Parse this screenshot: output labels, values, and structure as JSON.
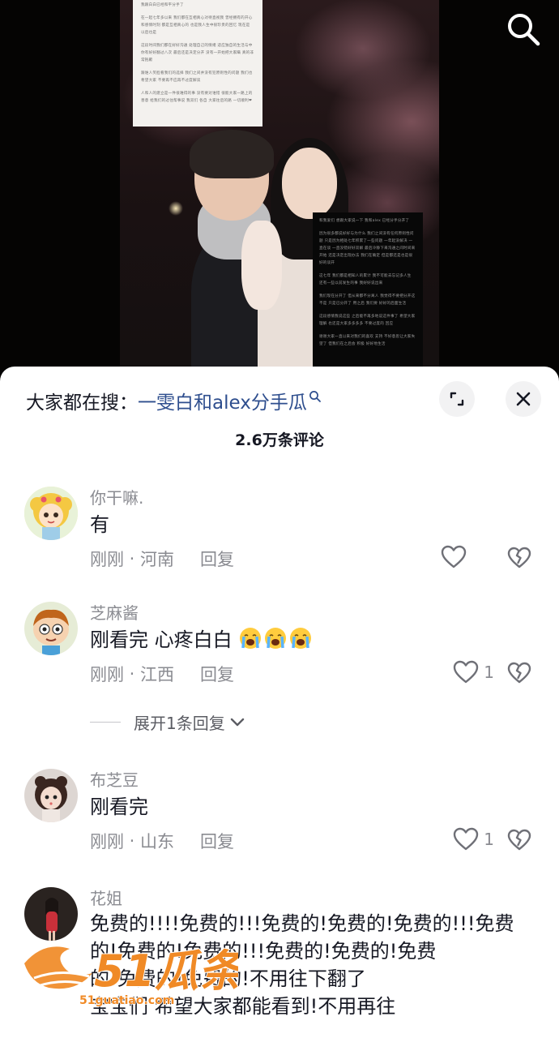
{
  "video": {
    "note_light_paragraphs": [
      "我跟白白已经和平分手了",
      "在一起七年多以来 我们都在互相真心对待直视我 曾经拥有的开心和感情时刻 都是互相真心的 也是我人生中很珍贵的回忆 现在是 以后也是",
      "这段时间我们都在好好沟通 处理自己的情绪 适应独自的生活与中 你有好好翻过八次 最后还是决定分开 没有一开始把大家瞒 真的非常抱歉",
      "跟谁人笑脸看我们的选择 我们之间并没有犯原则性的问题 我们也希望大家 不要再不应再不过度解读",
      "人和人的建立是一件很难得的事 没有要对谁错 很能大家一路上的善意 给我们的过往帮事说 我双们 各自 大家往后的路 一切顺利❤"
    ],
    "note_dark_paragraphs": [
      "和我爱们 想跟大家说一下 我和alex 已经分手分开了",
      "因为很多都说好好与为什么 我们之间没有任何原则性问题 只是因为相处七年积累了一些问题 一年起没解决 一直在谈 一直没错好好双解 最后冷静下来沟通之间时间来开始 还是决定出现办法 我们在确定 但是都还是也是很好的谈开",
      "这七年 我们都是相知人的累计 我不可能去忘记多人生 还有一些以前发生的事 我好好说出来",
      "我们现在分开了 但从来都不分离人 我觉得不要把分开这 不是 只是已分开了 用之后 我们要 好好的后面生活",
      "这段感情我说这些 之后能不再多地说这件事了 希望大家理解 也还是大家多多多多 不要过度的 回应",
      "谢谢大家一直以来对我们的喜欢 支持 不好意思让大家失望了 但我们在之后会 积极 好好地生活"
    ]
  },
  "header": {
    "hot_search_prefix": "大家都在搜：",
    "hot_search_term": "一雯白和alex分手瓜",
    "comment_count": "2.6万条评论"
  },
  "comments": [
    {
      "user": "你干嘛.",
      "text": "有",
      "time": "刚刚",
      "location": "河南",
      "reply": "回复",
      "likes": ""
    },
    {
      "user": "芝麻酱",
      "text": "刚看完 心疼白白",
      "emoji_count": 3,
      "time": "刚刚",
      "location": "江西",
      "reply": "回复",
      "likes": "1",
      "expand": "展开1条回复"
    },
    {
      "user": "布芝豆",
      "text": "刚看完",
      "time": "刚刚",
      "location": "山东",
      "reply": "回复",
      "likes": "1"
    },
    {
      "user": "花姐",
      "lines": [
        "免费的!!!!免费的!!!免费的!免费的!免费的!!!免费",
        "的!免费的!免费的!!!免费的!免费的!免费",
        "的!免费的!免费的!不用往下翻了",
        "宝宝们 希望大家都能看到!不用再往"
      ]
    }
  ],
  "watermark": {
    "brand": "51瓜条",
    "url": "51guatiao.com"
  },
  "colors": {
    "accent_blue": "#2e4e8e",
    "text_primary": "#161823",
    "text_secondary": "#8a8b91"
  }
}
